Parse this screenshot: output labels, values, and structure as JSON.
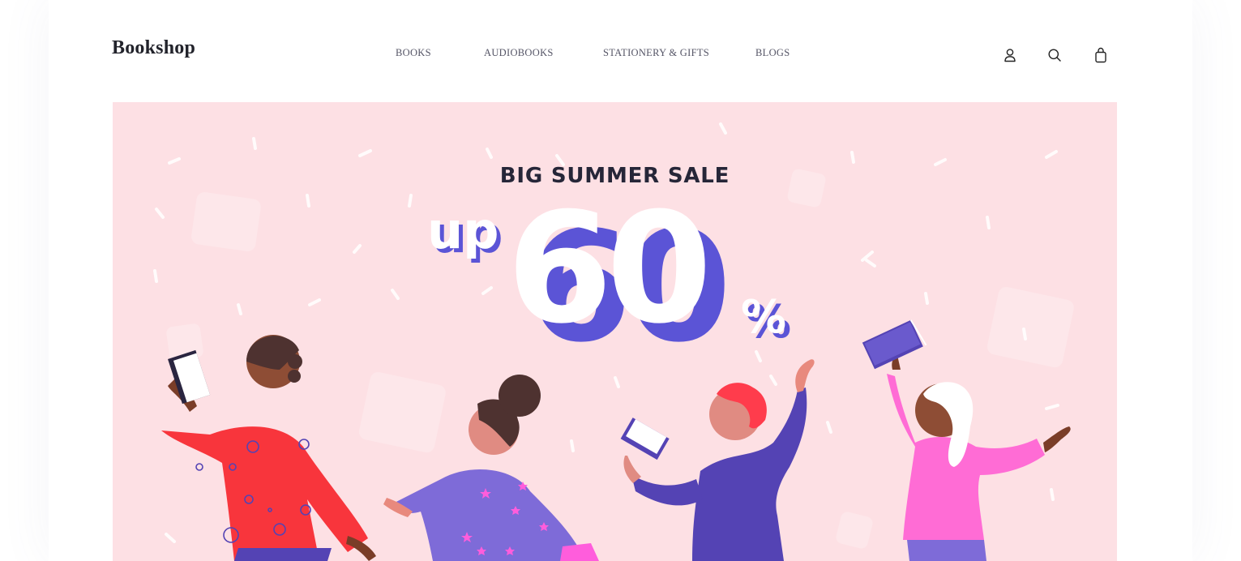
{
  "brand": {
    "name": "Bookshop"
  },
  "nav": {
    "items": [
      {
        "label": "BOOKS"
      },
      {
        "label": "AUDIOBOOKS"
      },
      {
        "label": "STATIONERY & GIFTS"
      },
      {
        "label": "BLOGS"
      }
    ]
  },
  "header_icons": {
    "account": "user-icon",
    "search": "search-icon",
    "cart": "shopping-bag-icon"
  },
  "hero": {
    "title": "BIG SUMMER SALE",
    "prefix": "up",
    "amount": "60",
    "suffix": "%",
    "colors": {
      "background": "#fde0e4",
      "accent": "#5b54d6",
      "text": "#262638"
    }
  }
}
